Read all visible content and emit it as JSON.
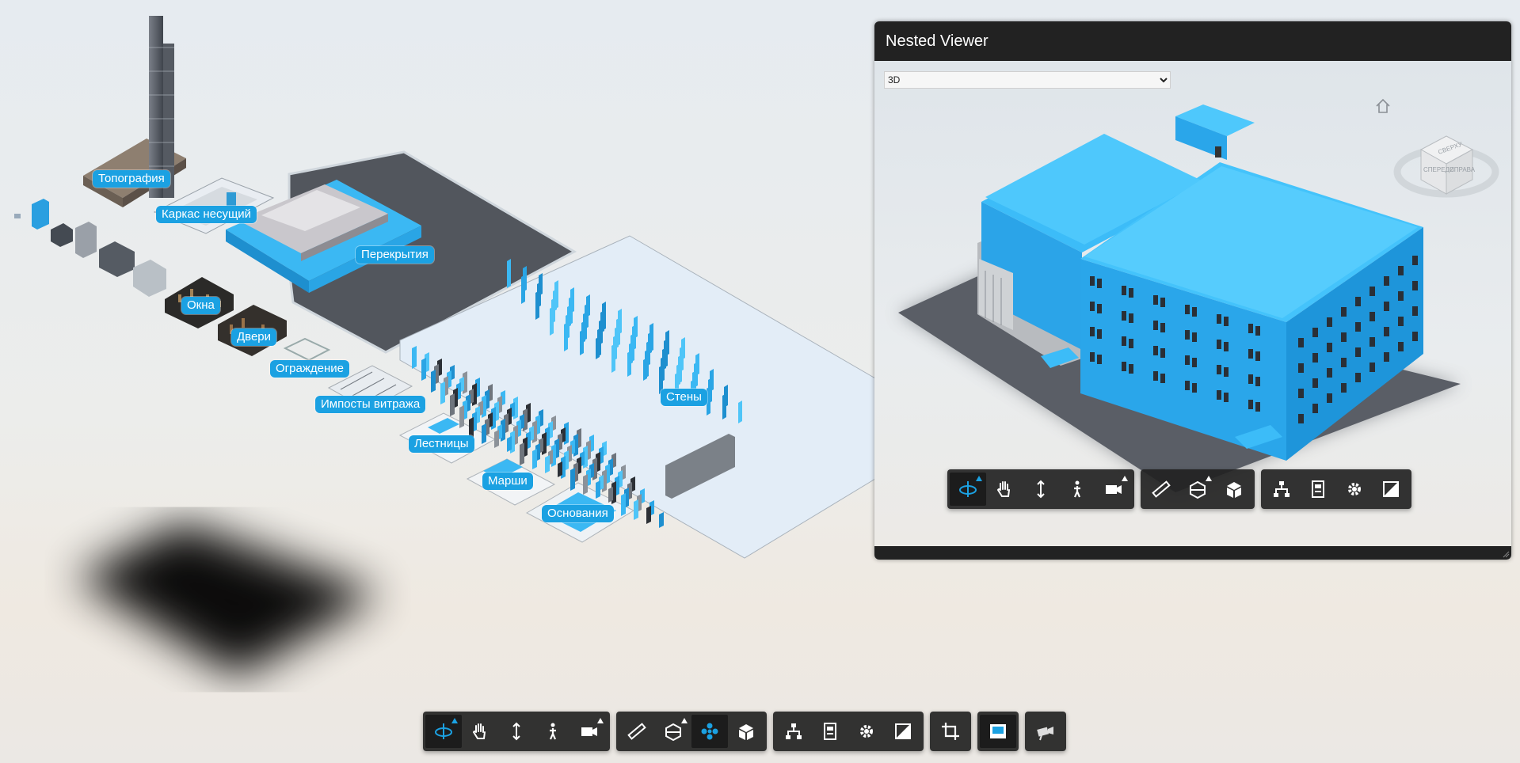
{
  "main": {
    "labels": {
      "topography": "Топография",
      "frame": "Каркас несущий",
      "floors": "Перекрытия",
      "windows": "Окна",
      "doors": "Двери",
      "railing": "Ограждение",
      "mullions": "Импосты витража",
      "stairs": "Лестницы",
      "runs": "Марши",
      "foundations": "Основания",
      "walls": "Стены"
    }
  },
  "nested_viewer": {
    "title": "Nested Viewer",
    "view_select": {
      "value": "3D",
      "options": [
        "3D"
      ]
    },
    "viewcube": {
      "top": "СВЕРХУ",
      "front": "СПЕРЕДИ",
      "right": "СПРАВА"
    }
  },
  "toolbar_icons": {
    "navigation": [
      "orbit-icon",
      "pan-icon",
      "dolly-icon",
      "walk-icon",
      "camera-icon"
    ],
    "modeling": [
      "measure-icon",
      "section-icon",
      "explode-icon",
      "model-icon"
    ],
    "settings": [
      "model-browser-icon",
      "properties-icon",
      "settings-icon",
      "fullscreen-icon"
    ],
    "extras": [
      "crop-icon",
      "split-view-icon",
      "camera-sync-icon"
    ]
  },
  "colors": {
    "accent": "#1ba1e2",
    "model_blue": "#3bb8f3",
    "toolbar_bg": "#222222",
    "header_bg": "#222222"
  }
}
